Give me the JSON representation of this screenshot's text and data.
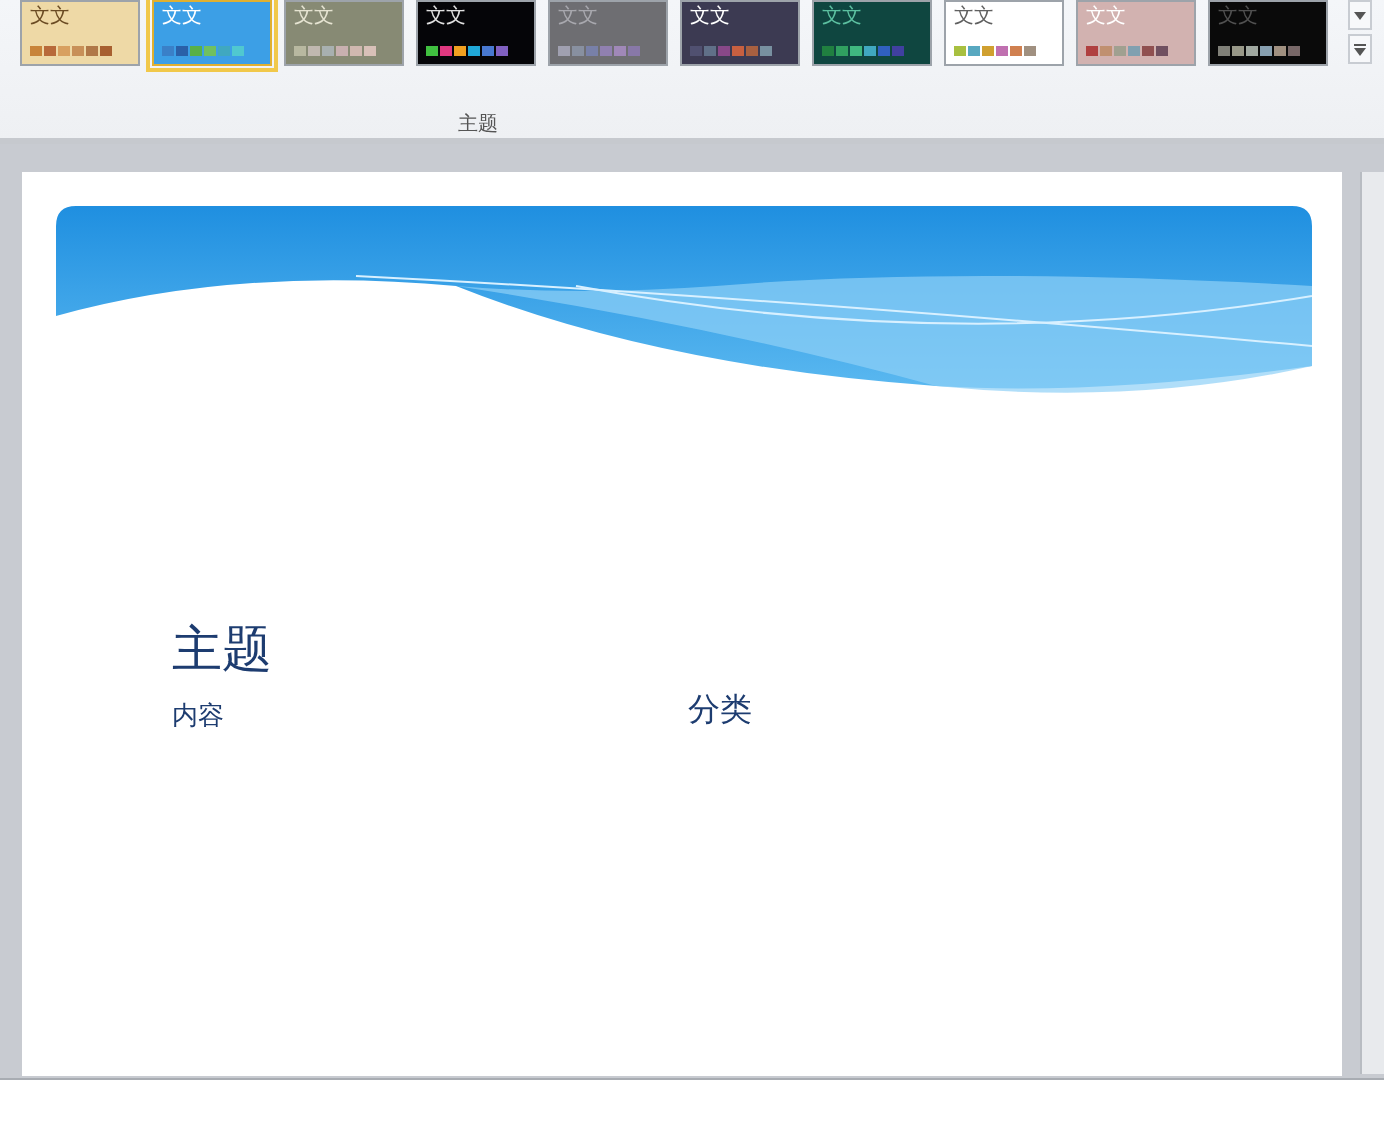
{
  "ribbon": {
    "theme_gallery": {
      "themes": [
        {
          "sample_text": "文文",
          "selected": false,
          "color": "#eed9a6"
        },
        {
          "sample_text": "文文",
          "selected": true,
          "color": "#3c9fe6"
        },
        {
          "sample_text": "文文",
          "selected": false,
          "color": "#878a74"
        },
        {
          "sample_text": "文文",
          "selected": false,
          "color": "#050508"
        },
        {
          "sample_text": "文文",
          "selected": false,
          "color": "#6e6e72"
        },
        {
          "sample_text": "文文",
          "selected": false,
          "color": "#3c3a52"
        },
        {
          "sample_text": "文文",
          "selected": false,
          "color": "#0f4640"
        },
        {
          "sample_text": "文文",
          "selected": false,
          "color": "#ffffff"
        },
        {
          "sample_text": "文文",
          "selected": false,
          "color": "#d2b2b0"
        },
        {
          "sample_text": "文文",
          "selected": false,
          "color": "#0a0a0a"
        }
      ]
    },
    "group_label": "主题"
  },
  "slide": {
    "title": "主题",
    "subtitle": "内容",
    "column_2": "分类"
  }
}
